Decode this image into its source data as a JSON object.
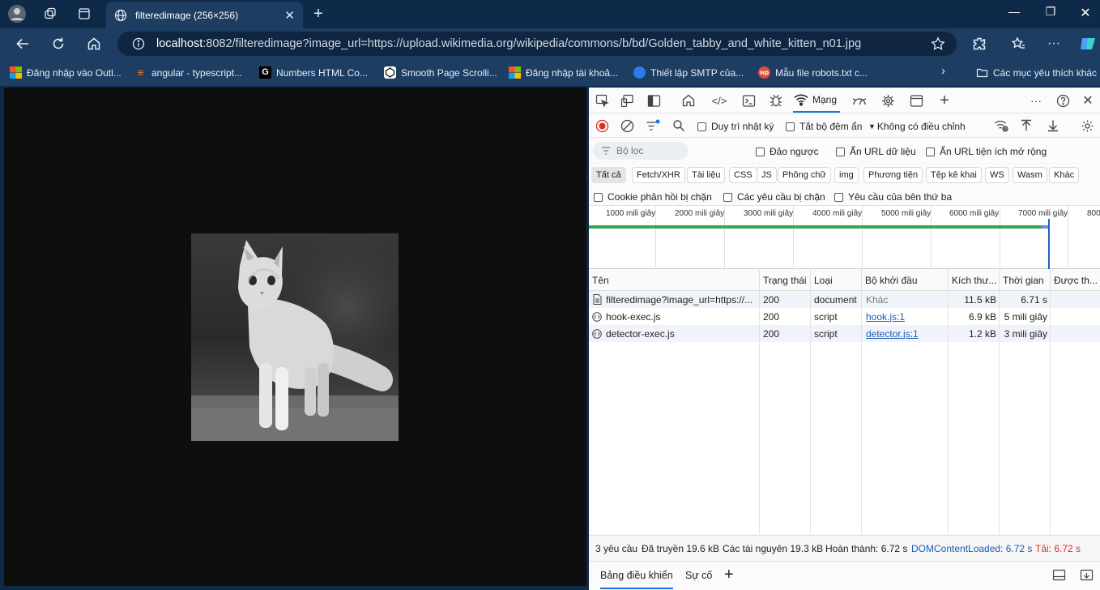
{
  "browser": {
    "tab_title": "filteredimage (256×256)",
    "url_host": "localhost",
    "url_rest": ":8082/filteredimage?image_url=https://upload.wikimedia.org/wikipedia/commons/b/bd/Golden_tabby_and_white_kitten_n01.jpg",
    "bookmarks": [
      {
        "label": "Đăng nhập vào Outl...",
        "icon": "microsoft-icon"
      },
      {
        "label": "angular - typescript...",
        "icon": "stackoverflow-icon"
      },
      {
        "label": "Numbers HTML Co...",
        "icon": "g-letter-icon"
      },
      {
        "label": "Smooth Page Scrolli...",
        "icon": "codepen-icon"
      },
      {
        "label": "Đăng nhập tài khoả...",
        "icon": "microsoft-icon"
      },
      {
        "label": "Thiết lập SMTP của...",
        "icon": "globe-icon"
      },
      {
        "label": "Mẫu file robots.txt c...",
        "icon": "wp-icon"
      }
    ],
    "bookmarks_folder": "Các mục yêu thích khác"
  },
  "devtools": {
    "network_tab": "Mạng",
    "preserve_log": "Duy trì nhật ký",
    "disable_cache": "Tắt bộ đệm ẩn",
    "throttling": "Không có điều chỉnh",
    "filter_placeholder": "Bộ lọc",
    "invert": "Đảo ngược",
    "hide_data_urls": "Ẩn URL dữ liệu",
    "hide_ext_urls": "Ẩn URL tiện ích mở rộng",
    "type_filters": [
      "Tất cả",
      "Fetch/XHR",
      "Tài liệu",
      "CSS",
      "JS",
      "Phông chữ",
      "img",
      "Phương tiện",
      "Tệp kê khai",
      "WS",
      "Wasm",
      "Khác"
    ],
    "blocked_cookies": "Cookie phản hồi bị chặn",
    "blocked_requests": "Các yêu cầu bị chặn",
    "third_party": "Yêu cầu của bên thứ ba",
    "timeline_ticks": [
      "1000 mili giây",
      "2000 mili giây",
      "3000 mili giây",
      "4000 mili giây",
      "5000 mili giây",
      "6000 mili giây",
      "7000 mili giây",
      "800"
    ],
    "columns": [
      "Tên",
      "Trạng thái",
      "Loại",
      "Bộ khởi đầu",
      "Kích thư...",
      "Thời gian",
      "Được th..."
    ],
    "rows": [
      {
        "name": "filteredimage?image_url=https://...",
        "status": "200",
        "type": "document",
        "initiator": "Khác",
        "size": "11.5 kB",
        "time": "6.71 s"
      },
      {
        "name": "hook-exec.js",
        "status": "200",
        "type": "script",
        "initiator": "hook.js:1",
        "size": "6.9 kB",
        "time": "5 mili giây"
      },
      {
        "name": "detector-exec.js",
        "status": "200",
        "type": "script",
        "initiator": "detector.js:1",
        "size": "1.2 kB",
        "time": "3 mili giây"
      }
    ],
    "status_bar": {
      "requests": "3 yêu cầu",
      "transferred": "Đã truyền 19.6 kB",
      "resources": "Các tài nguyên 19.3 kB",
      "finish": "Hoàn thành: 6.72 s",
      "dcl": "DOMContentLoaded: 6.72 s",
      "load": "Tải: 6.72 s"
    },
    "drawer_tabs": [
      "Bảng điều khiển",
      "Sự cố"
    ],
    "colors": {
      "dcl": "#1a5db8",
      "load": "#d93025",
      "waterfall": "#34a853"
    }
  }
}
